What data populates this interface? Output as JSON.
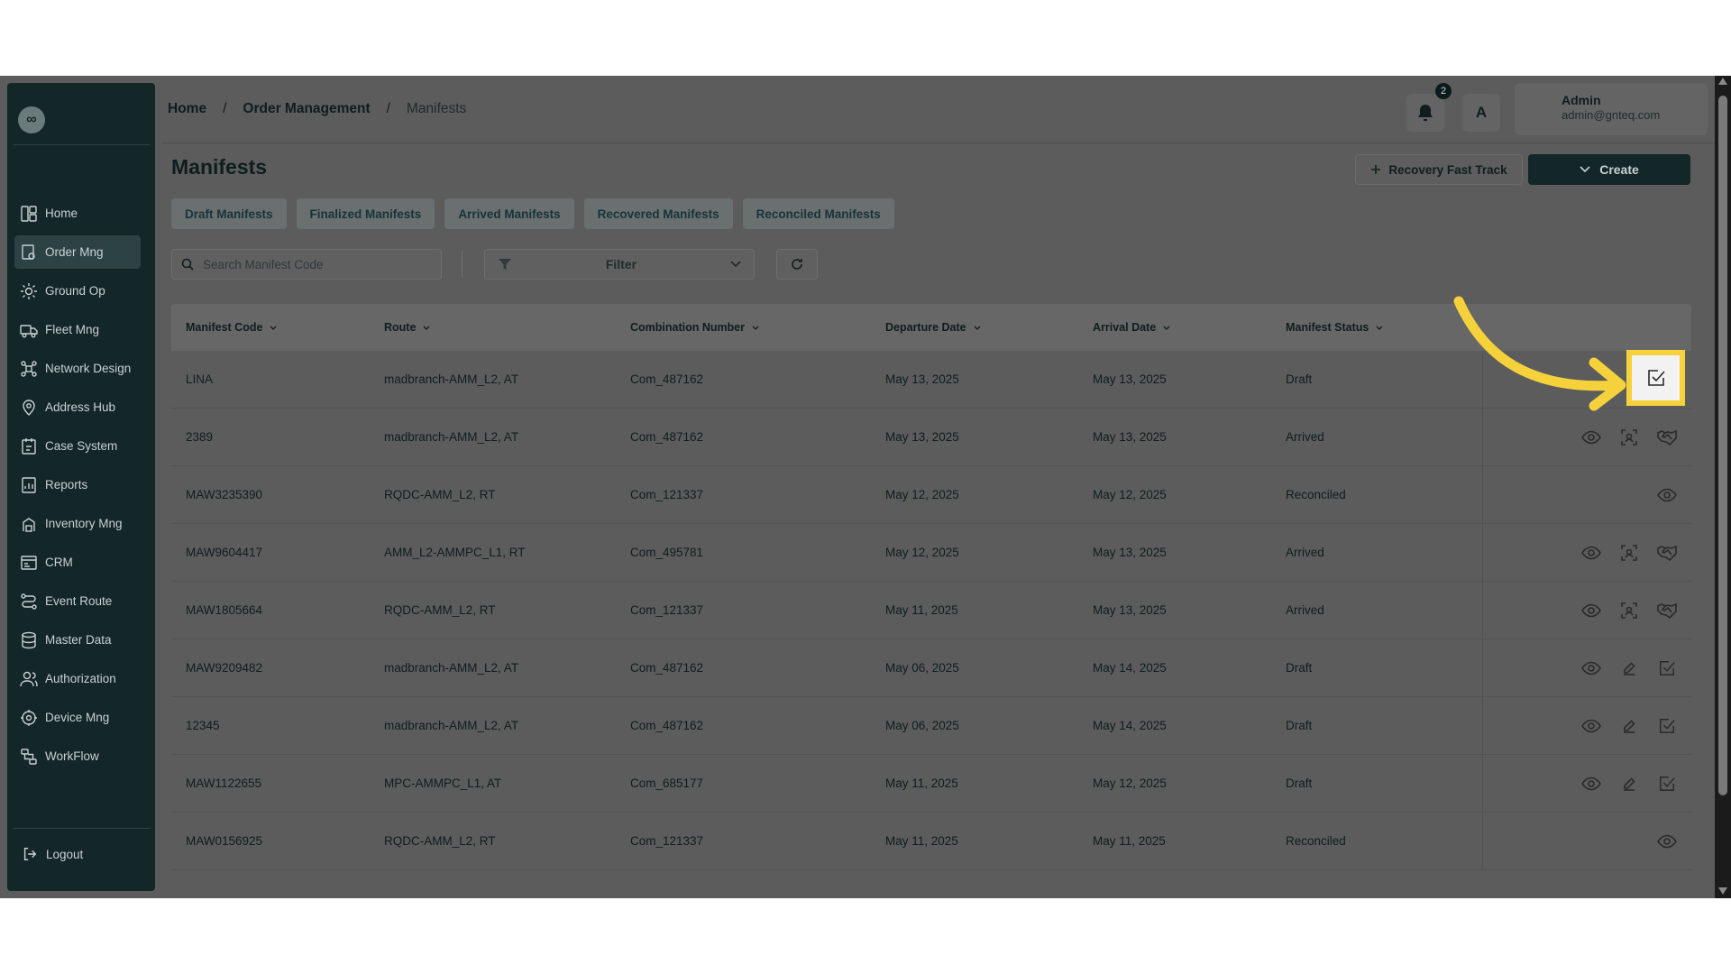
{
  "sidebar": {
    "logo": "∞",
    "items": [
      {
        "label": "Home",
        "icon": "grid-icon"
      },
      {
        "label": "Order Mng",
        "icon": "box-gear-icon",
        "active": true
      },
      {
        "label": "Ground Op",
        "icon": "sun-icon"
      },
      {
        "label": "Fleet Mng",
        "icon": "truck-icon"
      },
      {
        "label": "Network Design",
        "icon": "network-icon"
      },
      {
        "label": "Address Hub",
        "icon": "location-icon"
      },
      {
        "label": "Case System",
        "icon": "case-icon"
      },
      {
        "label": "Reports",
        "icon": "report-icon"
      },
      {
        "label": "Inventory Mng",
        "icon": "inventory-icon"
      },
      {
        "label": "CRM",
        "icon": "crm-icon"
      },
      {
        "label": "Event Route",
        "icon": "route-icon"
      },
      {
        "label": "Master Data",
        "icon": "database-icon"
      },
      {
        "label": "Authorization",
        "icon": "users-icon"
      },
      {
        "label": "Device Mng",
        "icon": "device-icon"
      },
      {
        "label": "WorkFlow",
        "icon": "workflow-icon"
      }
    ],
    "logout": "Logout"
  },
  "breadcrumb": {
    "home": "Home",
    "section": "Order Management",
    "current": "Manifests",
    "sep": "/"
  },
  "header": {
    "notifications": "2",
    "lang": "A",
    "user_name": "Admin",
    "user_email": "admin@gnteq.com"
  },
  "page": {
    "title": "Manifests",
    "recovery_label": "Recovery Fast Track",
    "create_label": "Create"
  },
  "tabs": [
    "Draft Manifests",
    "Finalized Manifests",
    "Arrived Manifests",
    "Recovered Manifests",
    "Reconciled Manifests"
  ],
  "search": {
    "placeholder": "Search Manifest Code"
  },
  "filter": {
    "label": "Filter"
  },
  "table": {
    "columns": [
      "Manifest Code",
      "Route",
      "Combination Number",
      "Departure Date",
      "Arrival Date",
      "Manifest Status"
    ],
    "rows": [
      [
        "LINA",
        "madbranch-AMM_L2, AT",
        "Com_487162",
        "May 13, 2025",
        "May 13, 2025",
        "Draft"
      ],
      [
        "2389",
        "madbranch-AMM_L2, AT",
        "Com_487162",
        "May 13, 2025",
        "May 13, 2025",
        "Arrived"
      ],
      [
        "MAW3235390",
        "RQDC-AMM_L2, RT",
        "Com_121337",
        "May 12, 2025",
        "May 12, 2025",
        "Reconciled"
      ],
      [
        "MAW9604417",
        "AMM_L2-AMMPC_L1, RT",
        "Com_495781",
        "May 12, 2025",
        "May 13, 2025",
        "Arrived"
      ],
      [
        "MAW1805664",
        "RQDC-AMM_L2, RT",
        "Com_121337",
        "May 11, 2025",
        "May 13, 2025",
        "Arrived"
      ],
      [
        "MAW9209482",
        "madbranch-AMM_L2, AT",
        "Com_487162",
        "May 06, 2025",
        "May 14, 2025",
        "Draft"
      ],
      [
        "12345",
        "madbranch-AMM_L2, AT",
        "Com_487162",
        "May 06, 2025",
        "May 14, 2025",
        "Draft"
      ],
      [
        "MAW1122655",
        "MPC-AMMPC_L1, AT",
        "Com_685177",
        "May 11, 2025",
        "May 12, 2025",
        "Draft"
      ],
      [
        "MAW0156925",
        "RQDC-AMM_L2, RT",
        "Com_121337",
        "May 11, 2025",
        "May 11, 2025",
        "Reconciled"
      ]
    ]
  },
  "colors": {
    "accent": "#132628",
    "highlight": "#f5d23c",
    "overlay": "#5c5c5c"
  }
}
